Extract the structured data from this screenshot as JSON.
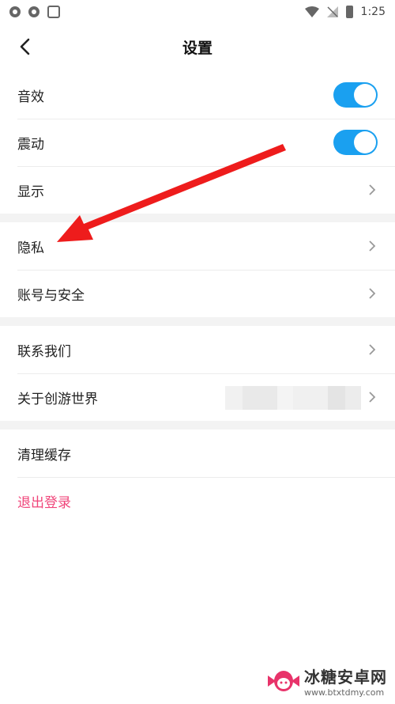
{
  "status_bar": {
    "time": "1:25"
  },
  "header": {
    "title": "设置"
  },
  "sections": [
    [
      {
        "label": "音效",
        "control": "toggle",
        "on": true
      },
      {
        "label": "震动",
        "control": "toggle",
        "on": true
      },
      {
        "label": "显示",
        "control": "chevron"
      }
    ],
    [
      {
        "label": "隐私",
        "control": "chevron"
      },
      {
        "label": "账号与安全",
        "control": "chevron"
      }
    ],
    [
      {
        "label": "联系我们",
        "control": "chevron"
      },
      {
        "label": "关于创游世界",
        "control": "chevron"
      }
    ],
    [
      {
        "label": "清理缓存",
        "control": "none"
      },
      {
        "label": "退出登录",
        "control": "none"
      }
    ]
  ],
  "colors": {
    "accent": "#1aa0f0",
    "logout": "#f0457a",
    "annotation_arrow": "#ee1c1c"
  },
  "watermark": {
    "name": "冰糖安卓网",
    "url": "www.btxtdmy.com"
  }
}
